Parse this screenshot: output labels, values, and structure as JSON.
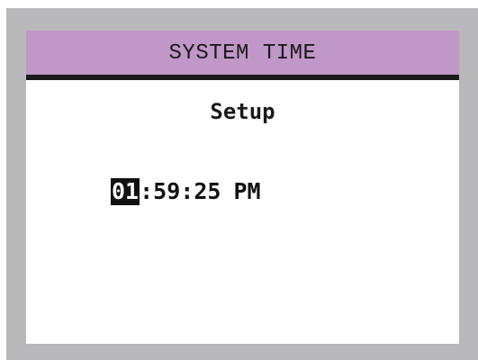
{
  "header": {
    "title": "SYSTEM TIME"
  },
  "subtitle": "Setup",
  "time": {
    "hours": "01",
    "sep1": ":",
    "minutes": "59",
    "sep2": ":",
    "seconds": "25",
    "period": "PM",
    "selected_field": "hours"
  },
  "colors": {
    "header_bg": "#c196c8",
    "header_rule": "#1a1a1a",
    "bezel": "#b9b9bb",
    "screen_bg": "#ffffff",
    "highlight_bg": "#111111",
    "highlight_text": "#ffffff"
  }
}
